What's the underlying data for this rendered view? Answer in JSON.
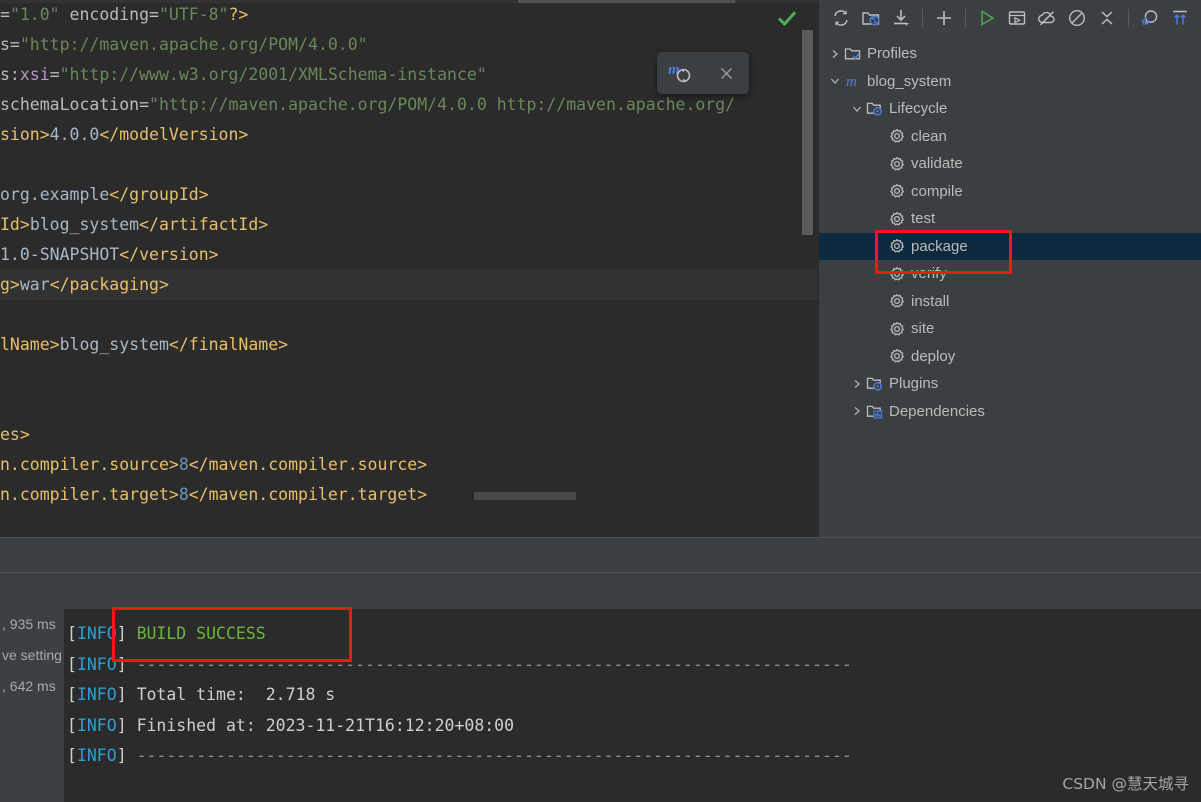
{
  "editor": {
    "file_lines": [
      [
        {
          "t": "=",
          "c": "tok-attr"
        },
        {
          "t": "\"1.0\"",
          "c": "tok-str"
        },
        {
          "t": " encoding",
          "c": "tok-attr"
        },
        {
          "t": "=",
          "c": "tok-attr"
        },
        {
          "t": "\"UTF-8\"",
          "c": "tok-str"
        },
        {
          "t": "?>",
          "c": "tok-punct"
        }
      ],
      [
        {
          "t": "s=",
          "c": "tok-attr"
        },
        {
          "t": "\"http://maven.apache.org/POM/4.0.0\"",
          "c": "tok-str"
        }
      ],
      [
        {
          "t": "s:",
          "c": "tok-attr"
        },
        {
          "t": "xsi",
          "c": "tok-attrns"
        },
        {
          "t": "=",
          "c": "tok-attr"
        },
        {
          "t": "\"http://www.w3.org/2001/XMLSchema-instance\"",
          "c": "tok-str"
        }
      ],
      [
        {
          "t": "schemaLocation",
          "c": "tok-attr"
        },
        {
          "t": "=",
          "c": "tok-attr"
        },
        {
          "t": "\"http://maven.apache.org/POM/4.0.0 http://maven.apache.org/",
          "c": "tok-str"
        }
      ],
      [
        {
          "t": "sion>",
          "c": "tok-tag"
        },
        {
          "t": "4.0.0",
          "c": "tok-text"
        },
        {
          "t": "</modelVersion>",
          "c": "tok-tag"
        }
      ],
      [],
      [
        {
          "t": "org.example",
          "c": "tok-text"
        },
        {
          "t": "</groupId>",
          "c": "tok-tag"
        }
      ],
      [
        {
          "t": "Id>",
          "c": "tok-tag"
        },
        {
          "t": "blog_system",
          "c": "tok-text"
        },
        {
          "t": "</artifactId>",
          "c": "tok-tag"
        }
      ],
      [
        {
          "t": "1.0-SNAPSHOT",
          "c": "tok-text"
        },
        {
          "t": "</version>",
          "c": "tok-tag"
        }
      ],
      [
        {
          "t": "g>",
          "c": "tok-tag"
        },
        {
          "t": "war",
          "c": "tok-text"
        },
        {
          "t": "</packaging>",
          "c": "tok-tag"
        }
      ],
      [],
      [
        {
          "t": "lName>",
          "c": "tok-tag"
        },
        {
          "t": "blog_system",
          "c": "tok-text"
        },
        {
          "t": "</finalName>",
          "c": "tok-tag"
        }
      ],
      [],
      [],
      [
        {
          "t": "es>",
          "c": "tok-tag"
        }
      ],
      [
        {
          "t": "n.compiler.source>",
          "c": "tok-tag"
        },
        {
          "t": "8",
          "c": "tok-num"
        },
        {
          "t": "</maven.compiler.source>",
          "c": "tok-tag"
        }
      ],
      [
        {
          "t": "n.compiler.target>",
          "c": "tok-tag"
        },
        {
          "t": "8",
          "c": "tok-num"
        },
        {
          "t": "</maven.compiler.target>",
          "c": "tok-tag"
        }
      ]
    ],
    "caret_line_index": 9,
    "inspection_status": "no-errors-check-icon",
    "scrollbar": "vertical-scrollbar"
  },
  "maven_popup": {
    "reload_label": "m",
    "reload_icon": "maven-reload-icon",
    "close_icon": "close-icon"
  },
  "maven_panel": {
    "toolbar": [
      {
        "name": "reimport-icon",
        "title": "Reload All Maven Projects"
      },
      {
        "name": "generate-sources-icon",
        "title": "Generate Sources and Update Folders"
      },
      {
        "name": "download-sources-icon",
        "title": "Download Sources and/or Documentation"
      },
      {
        "name": "add-maven-project-icon",
        "title": "Add Maven Project"
      },
      {
        "sep": true
      },
      {
        "name": "run-icon",
        "title": "Run Maven Build"
      },
      {
        "sep": true
      },
      {
        "name": "execute-goal-icon",
        "title": "Execute Maven Goal"
      },
      {
        "name": "toggle-offline-icon",
        "title": "Toggle Offline Mode"
      },
      {
        "name": "toggle-skip-tests-icon",
        "title": "Toggle 'Skip Tests' Mode"
      },
      {
        "name": "collapse-all-icon",
        "title": "Collapse All"
      },
      {
        "sep": true
      },
      {
        "name": "analyze-dependencies-icon",
        "title": "Analyze Dependencies"
      },
      {
        "name": "expand-collapse-icon",
        "title": "Expand/Collapse"
      }
    ],
    "tree": [
      {
        "label": "Profiles",
        "indent": 0,
        "arrow": "collapsed",
        "icon": "folder-check-icon",
        "selected": false
      },
      {
        "label": "blog_system",
        "indent": 0,
        "arrow": "expanded",
        "icon": "maven-module-icon",
        "selected": false
      },
      {
        "label": "Lifecycle",
        "indent": 1,
        "arrow": "expanded",
        "icon": "folder-gear-icon",
        "selected": false
      },
      {
        "label": "clean",
        "indent": 2,
        "arrow": "none",
        "icon": "goal-gear-icon",
        "selected": false
      },
      {
        "label": "validate",
        "indent": 2,
        "arrow": "none",
        "icon": "goal-gear-icon",
        "selected": false
      },
      {
        "label": "compile",
        "indent": 2,
        "arrow": "none",
        "icon": "goal-gear-icon",
        "selected": false
      },
      {
        "label": "test",
        "indent": 2,
        "arrow": "none",
        "icon": "goal-gear-icon",
        "selected": false
      },
      {
        "label": "package",
        "indent": 2,
        "arrow": "none",
        "icon": "goal-gear-icon",
        "selected": true
      },
      {
        "label": "verify",
        "indent": 2,
        "arrow": "none",
        "icon": "goal-gear-icon",
        "selected": false
      },
      {
        "label": "install",
        "indent": 2,
        "arrow": "none",
        "icon": "goal-gear-icon",
        "selected": false
      },
      {
        "label": "site",
        "indent": 2,
        "arrow": "none",
        "icon": "goal-gear-icon",
        "selected": false
      },
      {
        "label": "deploy",
        "indent": 2,
        "arrow": "none",
        "icon": "goal-gear-icon",
        "selected": false
      },
      {
        "label": "Plugins",
        "indent": 1,
        "arrow": "collapsed",
        "icon": "folder-gear-icon",
        "selected": false
      },
      {
        "label": "Dependencies",
        "indent": 1,
        "arrow": "collapsed",
        "icon": "folder-deps-icon",
        "selected": false
      }
    ]
  },
  "build_tree": [
    {
      "label": ", 935 ms"
    },
    {
      "label": "ve setting"
    },
    {
      "label": ", 642 ms"
    }
  ],
  "console": {
    "lines": [
      [
        {
          "t": "[",
          "c": "c-brack"
        },
        {
          "t": "INFO",
          "c": "c-info"
        },
        {
          "t": "] ",
          "c": "c-brack"
        },
        {
          "t": "BUILD SUCCESS",
          "c": "c-green"
        }
      ],
      [
        {
          "t": "[",
          "c": "c-brack"
        },
        {
          "t": "INFO",
          "c": "c-info"
        },
        {
          "t": "] ",
          "c": "c-brack"
        },
        {
          "t": "------------------------------------------------------------------------",
          "c": "c-dash"
        }
      ],
      [
        {
          "t": "[",
          "c": "c-brack"
        },
        {
          "t": "INFO",
          "c": "c-info"
        },
        {
          "t": "] ",
          "c": "c-brack"
        },
        {
          "t": "Total time:  2.718 s",
          "c": "c-white"
        }
      ],
      [
        {
          "t": "[",
          "c": "c-brack"
        },
        {
          "t": "INFO",
          "c": "c-info"
        },
        {
          "t": "] ",
          "c": "c-brack"
        },
        {
          "t": "Finished at: 2023-11-21T16:12:20+08:00",
          "c": "c-white"
        }
      ],
      [
        {
          "t": "[",
          "c": "c-brack"
        },
        {
          "t": "INFO",
          "c": "c-info"
        },
        {
          "t": "] ",
          "c": "c-brack"
        },
        {
          "t": "------------------------------------------------------------------------",
          "c": "c-dash"
        }
      ]
    ]
  },
  "annotations": {
    "package_highlight": "red-rectangle-around-package-goal",
    "build_success_highlight": "red-rectangle-around-build-success"
  },
  "watermark": {
    "text": "CSDN @慧天城寻"
  },
  "colors": {
    "editor_bg": "#2b2b2b",
    "panel_bg": "#3c3f41",
    "selection_blue": "#0d293e",
    "annotation_red": "#f11717",
    "success_green": "#6cb33f",
    "info_blue": "#2a9fd6"
  }
}
